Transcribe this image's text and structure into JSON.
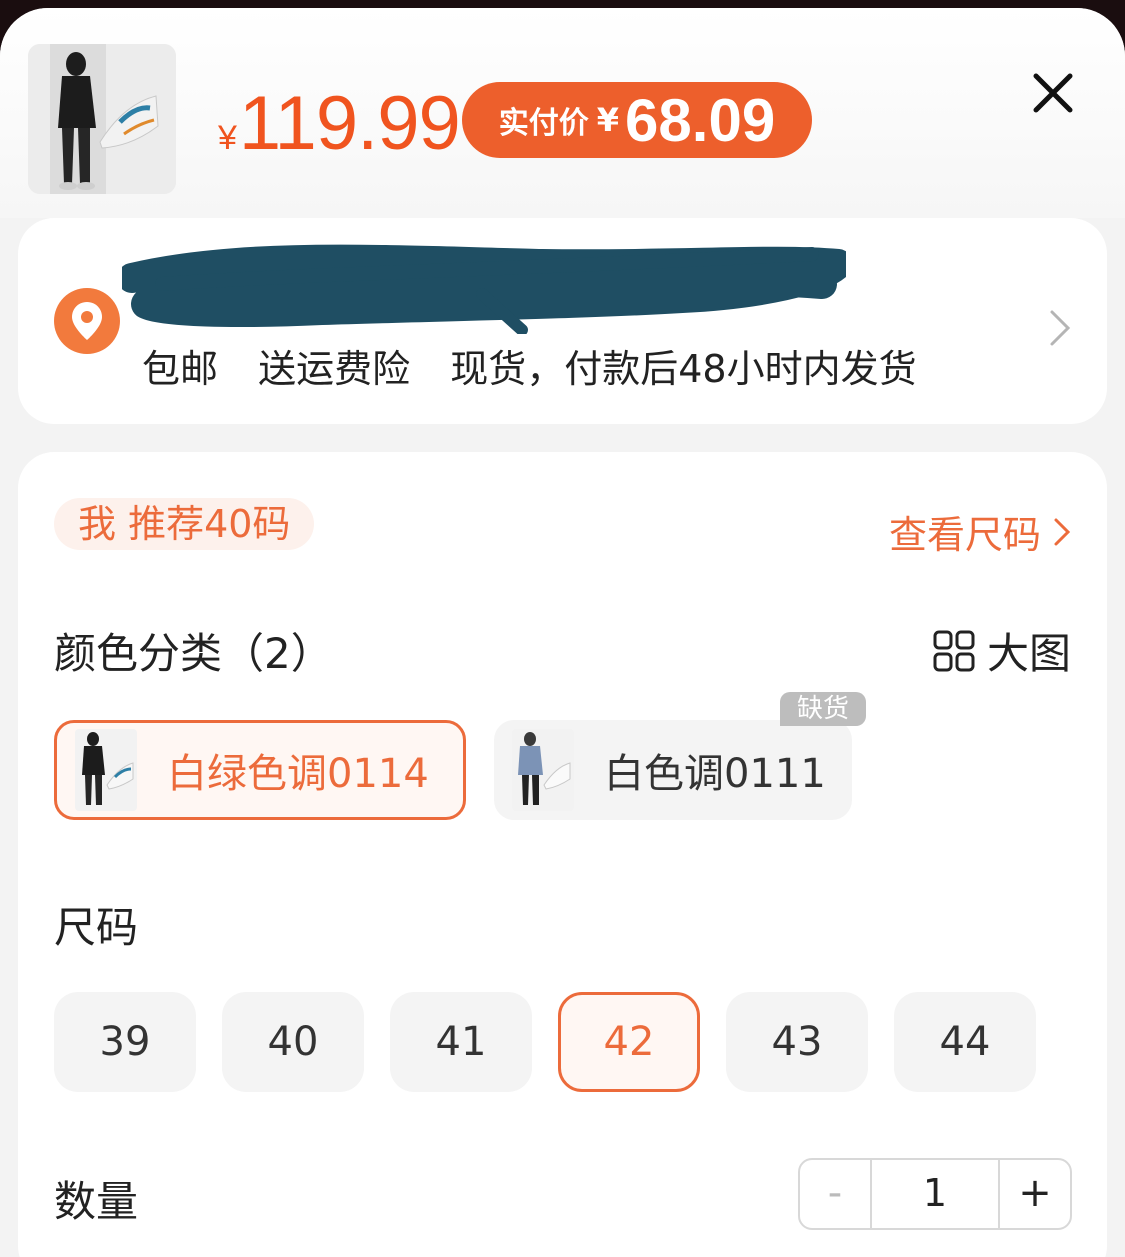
{
  "header": {
    "price_currency": "¥",
    "price": "119.99",
    "pay_label": "实付价",
    "pay_currency": "¥",
    "pay_price": "68.09"
  },
  "address": {
    "name_text": "",
    "shipping": [
      "包邮",
      "送运费险",
      "现货，付款后48小时内发货"
    ]
  },
  "recommend": {
    "label": "我 推荐40码",
    "size_guide": "查看尺码"
  },
  "color": {
    "title": "颜色分类（2）",
    "big_view": "大图",
    "out_of_stock_tag": "缺货",
    "options": [
      {
        "label": "白绿色调0114",
        "selected": true
      },
      {
        "label": "白色调0111",
        "selected": false
      }
    ]
  },
  "size": {
    "title": "尺码",
    "options": [
      "39",
      "40",
      "41",
      "42",
      "43",
      "44"
    ],
    "selected": "42"
  },
  "quantity": {
    "title": "数量",
    "minus": "-",
    "value": "1",
    "plus": "+"
  },
  "colors": {
    "accent": "#ec6b3b",
    "price": "#f0541f",
    "badge": "#ed5f2c"
  }
}
